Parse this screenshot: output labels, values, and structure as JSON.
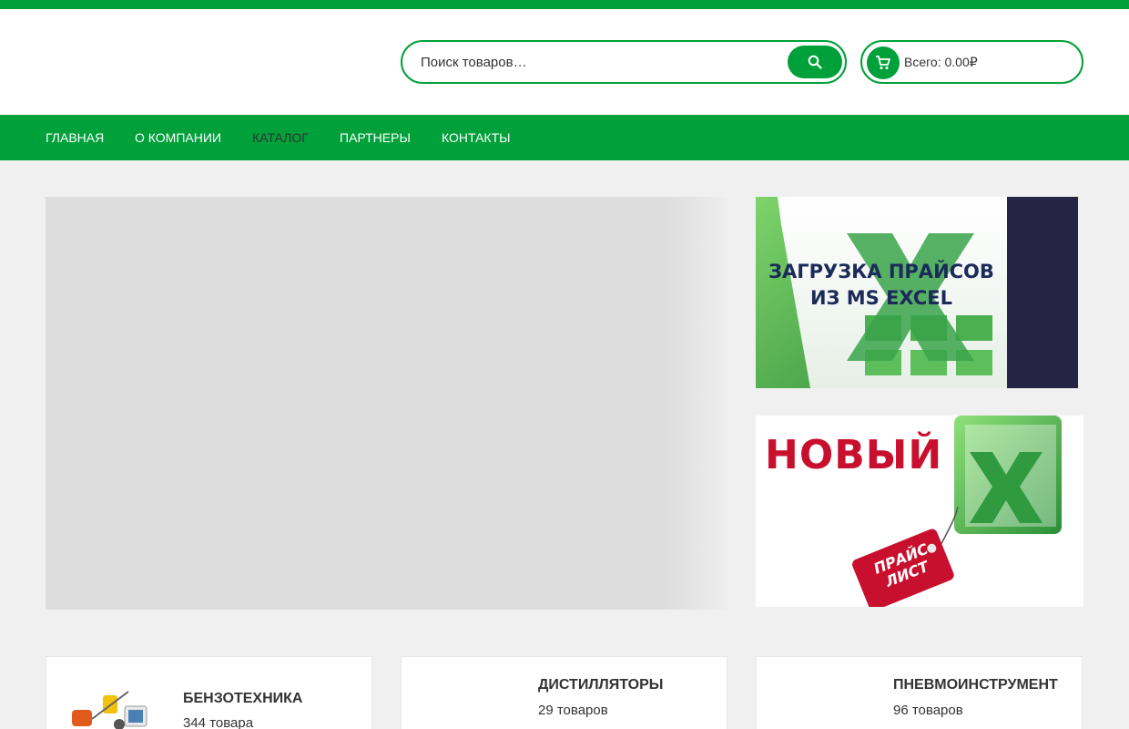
{
  "header": {
    "search": {
      "placeholder": "Поиск товаров…",
      "button_icon": "search-icon"
    },
    "cart": {
      "label": "Всего: 0.00₽",
      "icon": "cart-icon"
    }
  },
  "nav": {
    "items": [
      {
        "label": "ГЛАВНАЯ",
        "active": false
      },
      {
        "label": "О КОМПАНИИ",
        "active": false
      },
      {
        "label": "КАТАЛОГ",
        "active": true
      },
      {
        "label": "ПАРТНЕРЫ",
        "active": false
      },
      {
        "label": "КОНТАКТЫ",
        "active": false
      }
    ]
  },
  "banners": {
    "excel_upload": {
      "line1": "ЗАГРУЗКА ПРАЙСОВ",
      "line2": "ИЗ MS EXCEL"
    },
    "new_price": {
      "headline": "НОВЫЙ",
      "tag_line1": "ПРАЙС",
      "tag_line2": "ЛИСТ"
    }
  },
  "categories": [
    {
      "title": "БЕНЗОТЕХНИКА",
      "count": "344 товара"
    },
    {
      "title": "ДИСТИЛЛЯТОРЫ",
      "count": "29 товаров"
    },
    {
      "title": "ПНЕВМОИНСТРУМЕНТ",
      "count": "96 товаров"
    }
  ],
  "colors": {
    "brand_green": "#00a03a",
    "excel_green": "#2e9b3a",
    "banner_red": "#c8102e",
    "banner_navy": "#252444"
  }
}
